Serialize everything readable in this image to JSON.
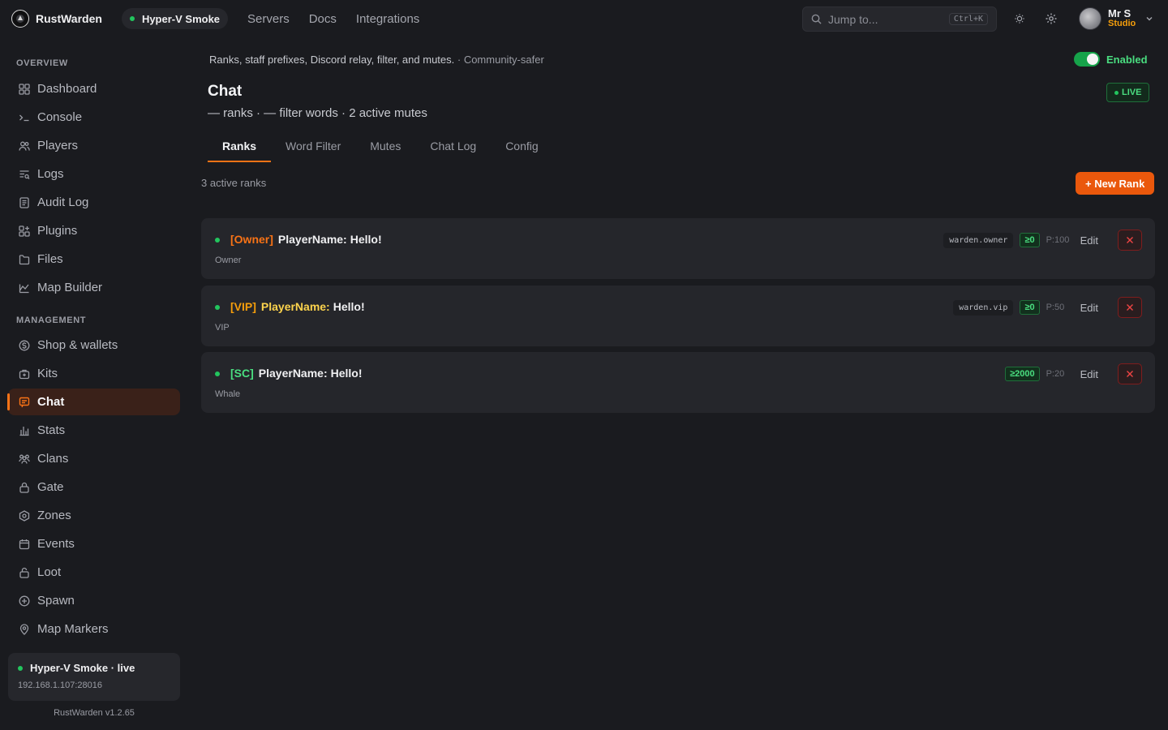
{
  "app": {
    "name": "RustWarden",
    "version": "RustWarden v1.2.65"
  },
  "topbar": {
    "server": "Hyper-V Smoke",
    "nav": [
      "Servers",
      "Docs",
      "Integrations"
    ],
    "search_placeholder": "Jump to...",
    "search_shortcut": "Ctrl+K",
    "user": {
      "name": "Mr S",
      "org": "Studio"
    }
  },
  "sidebar": {
    "overview_label": "OVERVIEW",
    "overview": [
      {
        "label": "Dashboard",
        "icon": "grid-icon"
      },
      {
        "label": "Console",
        "icon": "terminal-icon"
      },
      {
        "label": "Players",
        "icon": "users-icon"
      },
      {
        "label": "Logs",
        "icon": "logs-icon"
      },
      {
        "label": "Audit Log",
        "icon": "document-icon"
      },
      {
        "label": "Plugins",
        "icon": "plugins-icon"
      },
      {
        "label": "Files",
        "icon": "file-icon"
      },
      {
        "label": "Map Builder",
        "icon": "map-builder-icon"
      }
    ],
    "management_label": "MANAGEMENT",
    "management": [
      {
        "label": "Shop & wallets",
        "icon": "coin-icon"
      },
      {
        "label": "Kits",
        "icon": "kit-icon"
      },
      {
        "label": "Chat",
        "icon": "chat-icon",
        "active": true
      },
      {
        "label": "Stats",
        "icon": "bar-chart-icon"
      },
      {
        "label": "Clans",
        "icon": "clans-icon"
      },
      {
        "label": "Gate",
        "icon": "lock-icon"
      },
      {
        "label": "Zones",
        "icon": "zone-icon"
      },
      {
        "label": "Events",
        "icon": "calendar-icon"
      },
      {
        "label": "Loot",
        "icon": "loot-icon"
      },
      {
        "label": "Spawn",
        "icon": "plus-circle-icon"
      },
      {
        "label": "Map Markers",
        "icon": "pin-icon"
      }
    ],
    "status": {
      "title": "Hyper-V Smoke · live",
      "address": "192.168.1.107:28016"
    }
  },
  "main": {
    "description": "Ranks, staff prefixes, Discord relay, filter, and mutes.",
    "description_tag": "· Community-safer",
    "toggle_label": "Enabled",
    "title": "Chat",
    "live": "LIVE",
    "subtitle": "— ranks · — filter words · 2 active mutes",
    "tabs": [
      "Ranks",
      "Word Filter",
      "Mutes",
      "Chat Log",
      "Config"
    ],
    "active_tab": 0,
    "count_text": "3 active ranks",
    "new_button": "+ New Rank",
    "edit_label": "Edit",
    "ranks": [
      {
        "prefix": "[Owner]",
        "prefix_color": "#f97316",
        "player": "PlayerName:",
        "player_color": "#f0f0f2",
        "message": "Hello!",
        "label": "Owner",
        "permission": "warden.owner",
        "min": "≥0",
        "priority": "P:100"
      },
      {
        "prefix": "[VIP]",
        "prefix_color": "#f59e0b",
        "player": "PlayerName:",
        "player_color": "#fcd34d",
        "message": "Hello!",
        "label": "VIP",
        "permission": "warden.vip",
        "min": "≥0",
        "priority": "P:50"
      },
      {
        "prefix": "[SC]",
        "prefix_color": "#4ade80",
        "player": "PlayerName:",
        "player_color": "#f0f0f2",
        "message": "Hello!",
        "label": "Whale",
        "permission": "",
        "min": "≥2000",
        "priority": "P:20"
      }
    ]
  }
}
